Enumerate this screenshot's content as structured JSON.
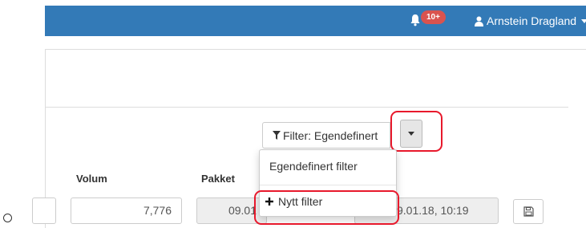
{
  "navbar": {
    "notification_count": "10+",
    "user_name": "Arnstein Dragland",
    "bar_color": "#337ab7",
    "badge_color": "#d9534f"
  },
  "filter": {
    "button_label": "Filter: Egendefinert",
    "filter_icon": "filter-funnel-icon",
    "toggle_icon": "caret-down-icon"
  },
  "table": {
    "headers": [
      "Volum",
      "Pakket"
    ],
    "row": {
      "volum": "7,776",
      "pakket": "09.01",
      "pakket_time": "9.01.18, 10:19",
      "save_icon": "floppy-disk-icon"
    }
  },
  "dropdown": {
    "items": [
      {
        "label": "Egendefinert filter"
      },
      {
        "label": "Nytt filter",
        "icon": "plus-icon"
      }
    ]
  },
  "annotation": {
    "highlight_color": "#e8192c"
  }
}
